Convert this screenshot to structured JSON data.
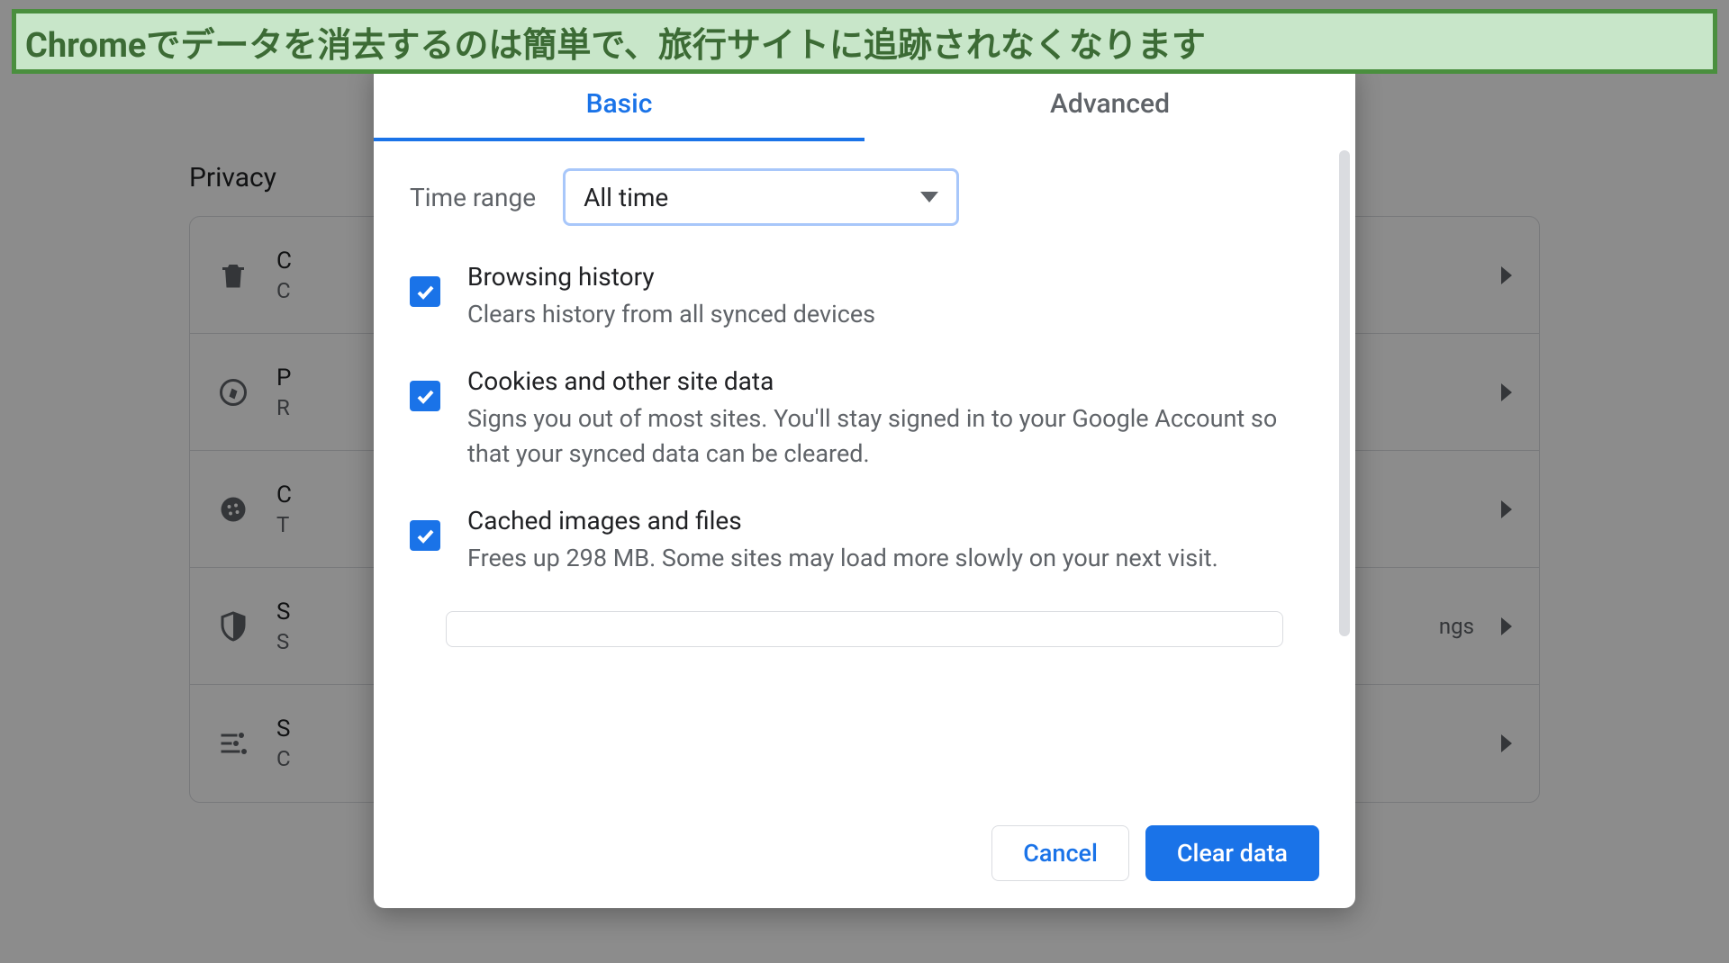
{
  "banner": {
    "text": "Chromeでデータを消去するのは簡単で、旅行サイトに追跡されなくなります"
  },
  "page": {
    "section_title": "Privacy",
    "items": [
      {
        "title_fragment": "C",
        "sub_fragment": "C"
      },
      {
        "title_fragment": "P",
        "sub_fragment": "R"
      },
      {
        "title_fragment": "C",
        "sub_fragment": "T"
      },
      {
        "title_fragment": "S",
        "sub_fragment": "S"
      },
      {
        "title_fragment": "S",
        "sub_fragment": "C"
      }
    ],
    "right_fragment": "ngs"
  },
  "dialog": {
    "tabs": [
      {
        "label": "Basic",
        "active": true
      },
      {
        "label": "Advanced",
        "active": false
      }
    ],
    "time_range": {
      "label": "Time range",
      "selected": "All time"
    },
    "options": [
      {
        "title": "Browsing history",
        "description": "Clears history from all synced devices",
        "checked": true
      },
      {
        "title": "Cookies and other site data",
        "description": "Signs you out of most sites. You'll stay signed in to your Google Account so that your synced data can be cleared.",
        "checked": true
      },
      {
        "title": "Cached images and files",
        "description": "Frees up 298 MB. Some sites may load more slowly on your next visit.",
        "checked": true
      }
    ],
    "buttons": {
      "cancel": "Cancel",
      "confirm": "Clear data"
    }
  }
}
